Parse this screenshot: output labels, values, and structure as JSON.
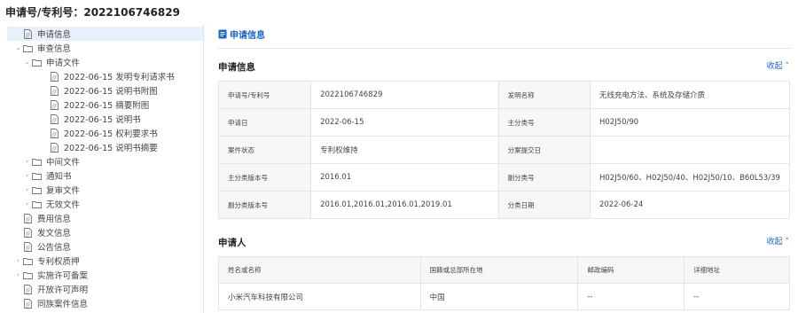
{
  "header": {
    "title": "申请号/专利号：2022106746829"
  },
  "sidebar": {
    "items": [
      {
        "label": "申请信息",
        "level": 0,
        "type": "doc",
        "arrow": "",
        "selected": true
      },
      {
        "label": "审查信息",
        "level": 0,
        "type": "folder",
        "arrow": "expanded"
      },
      {
        "label": "申请文件",
        "level": 1,
        "type": "folder",
        "arrow": "expanded"
      },
      {
        "label": "2022-06-15 发明专利请求书",
        "level": 2,
        "type": "doc",
        "arrow": ""
      },
      {
        "label": "2022-06-15 说明书附图",
        "level": 2,
        "type": "doc",
        "arrow": ""
      },
      {
        "label": "2022-06-15 摘要附图",
        "level": 2,
        "type": "doc",
        "arrow": ""
      },
      {
        "label": "2022-06-15 说明书",
        "level": 2,
        "type": "doc",
        "arrow": ""
      },
      {
        "label": "2022-06-15 权利要求书",
        "level": 2,
        "type": "doc",
        "arrow": ""
      },
      {
        "label": "2022-06-15 说明书摘要",
        "level": 2,
        "type": "doc",
        "arrow": ""
      },
      {
        "label": "中间文件",
        "level": 1,
        "type": "folder",
        "arrow": "collapsed"
      },
      {
        "label": "通知书",
        "level": 1,
        "type": "folder",
        "arrow": "collapsed"
      },
      {
        "label": "复审文件",
        "level": 1,
        "type": "folder",
        "arrow": "collapsed"
      },
      {
        "label": "无效文件",
        "level": 1,
        "type": "folder",
        "arrow": "collapsed"
      },
      {
        "label": "费用信息",
        "level": 0,
        "type": "doc",
        "arrow": ""
      },
      {
        "label": "发文信息",
        "level": 0,
        "type": "doc",
        "arrow": ""
      },
      {
        "label": "公告信息",
        "level": 0,
        "type": "doc",
        "arrow": ""
      },
      {
        "label": "专利权质押",
        "level": 0,
        "type": "folder",
        "arrow": "collapsed"
      },
      {
        "label": "实施许可备案",
        "level": 0,
        "type": "folder",
        "arrow": "collapsed"
      },
      {
        "label": "开放许可声明",
        "level": 0,
        "type": "doc",
        "arrow": ""
      },
      {
        "label": "同族案件信息",
        "level": 0,
        "type": "doc",
        "arrow": ""
      }
    ]
  },
  "main": {
    "tab_label": "申请信息",
    "collapse_label": "收起",
    "application_info": {
      "title": "申请信息",
      "rows": [
        [
          "申请号/专利号",
          "2022106746829",
          "发明名称",
          "无线充电方法、系统及存储介质"
        ],
        [
          "申请日",
          "2022-06-15",
          "主分类号",
          "H02J50/90"
        ],
        [
          "案件状态",
          "专利权维持",
          "分案提交日",
          ""
        ],
        [
          "主分类版本号",
          "2016.01",
          "副分类号",
          "H02J50/60、H02J50/40、H02J50/10、B60L53/39"
        ],
        [
          "副分类版本号",
          "2016.01,2016.01,2016.01,2019.01",
          "分类日期",
          "2022-06-24"
        ]
      ]
    },
    "applicant": {
      "title": "申请人",
      "columns": [
        "姓名或名称",
        "国籍或总部所在地",
        "邮政编码",
        "详细地址"
      ],
      "rows": [
        [
          "小米汽车科技有限公司",
          "中国",
          "--",
          "--"
        ]
      ]
    }
  },
  "colors": {
    "accent": "#1a66c8",
    "selected_bg": "#e8f0fd",
    "header_cell_bg": "#f7f7f7",
    "border": "#e4e4e4"
  }
}
